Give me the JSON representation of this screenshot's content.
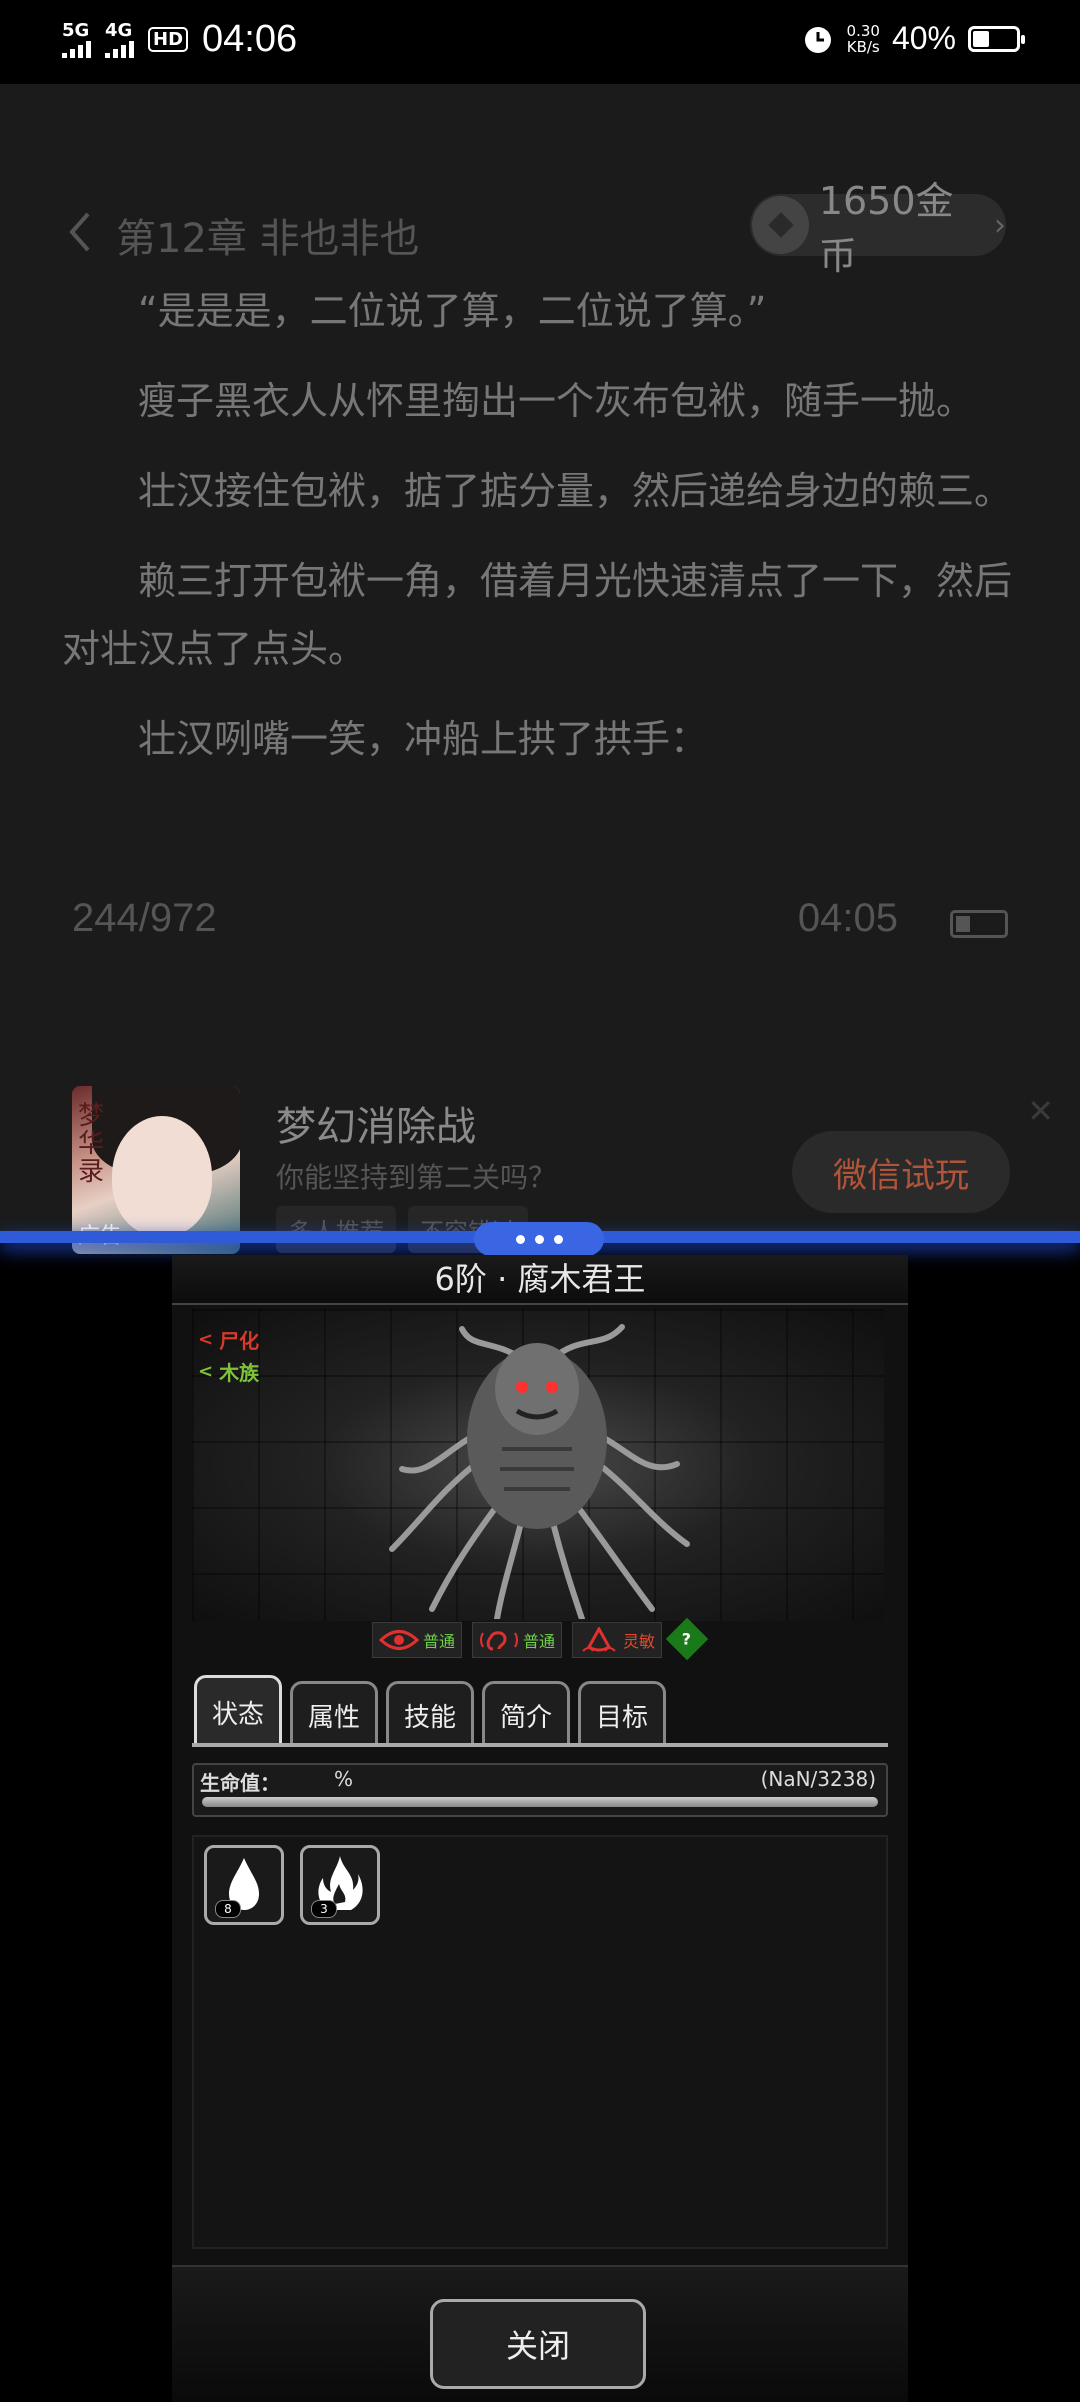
{
  "status_bar": {
    "sim1": "5G",
    "sim2": "4G",
    "hd": "HD",
    "time": "04:06",
    "speed_value": "0.30",
    "speed_unit": "KB/s",
    "battery": "40%"
  },
  "reader": {
    "chapter_title": "第12章 非也非也",
    "coins": "1650金币",
    "paragraphs": [
      "“是是是，二位说了算，二位说了算。”",
      "瘦子黑衣人从怀里掏出一个灰布包袱，随手一抛。",
      "壮汉接住包袱，掂了掂分量，然后递给身边的赖三。",
      "赖三打开包袱一角，借着月光快速清点了一下，然后对壮汉点了点头。",
      "壮汉咧嘴一笑，冲船上拱了拱手："
    ],
    "page": "244/972",
    "time": "04:05"
  },
  "ad": {
    "image_text": "梦华录",
    "label": "广告",
    "title": "梦幻消除战",
    "subtitle": "你能坚持到第二关吗？",
    "tags": [
      "多人推荐",
      "不容错过"
    ],
    "cta": "微信试玩"
  },
  "game": {
    "monster_title": "6阶 · 腐木君王",
    "traits": [
      {
        "name": "尸化",
        "color": "#d83a2a"
      },
      {
        "name": "木族",
        "color": "#7fc23a"
      }
    ],
    "senses": [
      {
        "icon": "eye-icon",
        "label": "普通",
        "label_color": "#6fd04a"
      },
      {
        "icon": "ear-icon",
        "label": "普通",
        "label_color": "#6fd04a"
      },
      {
        "icon": "nose-icon",
        "label": "灵敏",
        "label_color": "#e24a2a"
      }
    ],
    "help": "?",
    "tabs": [
      "状态",
      "属性",
      "技能",
      "简介",
      "目标"
    ],
    "active_tab": "状态",
    "hp": {
      "label": "生命值：",
      "percent": "%",
      "value": "(NaN/3238)"
    },
    "buffs": [
      {
        "icon": "flame-drop-icon",
        "count": "8"
      },
      {
        "icon": "fire-icon",
        "count": "3"
      }
    ],
    "close_label": "关闭"
  }
}
